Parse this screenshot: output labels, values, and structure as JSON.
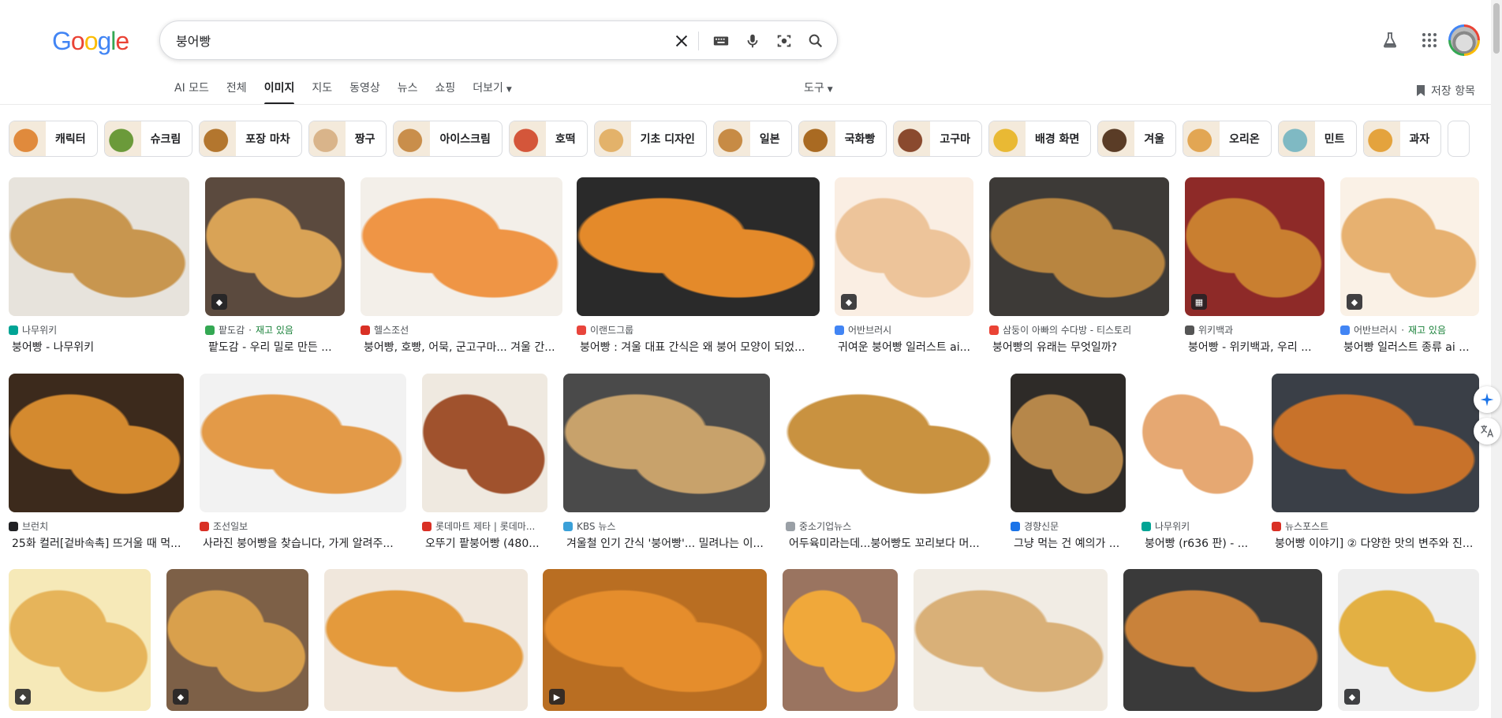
{
  "search": {
    "query": "붕어빵"
  },
  "logo": [
    "G",
    "o",
    "o",
    "g",
    "l",
    "e"
  ],
  "colors": {
    "blue": "#4285f4",
    "red": "#ea4335",
    "yellow": "#fbbc05",
    "green": "#34a853",
    "stock_green": "#188038"
  },
  "tabs": [
    {
      "label": "AI 모드",
      "active": false
    },
    {
      "label": "전체",
      "active": false
    },
    {
      "label": "이미지",
      "active": true
    },
    {
      "label": "지도",
      "active": false
    },
    {
      "label": "동영상",
      "active": false
    },
    {
      "label": "뉴스",
      "active": false
    },
    {
      "label": "쇼핑",
      "active": false
    },
    {
      "label": "더보기",
      "active": false
    }
  ],
  "tools_label": "도구",
  "saved_label": "저장 항목",
  "chips": [
    {
      "label": "캐릭터",
      "color": "#e08a3c"
    },
    {
      "label": "슈크림",
      "color": "#6b9a3a"
    },
    {
      "label": "포장 마차",
      "color": "#b3762e"
    },
    {
      "label": "짱구",
      "color": "#d9b48a"
    },
    {
      "label": "아이스크림",
      "color": "#c98e4b"
    },
    {
      "label": "호떡",
      "color": "#d4563a"
    },
    {
      "label": "기초 디자인",
      "color": "#e3b26a"
    },
    {
      "label": "일본",
      "color": "#c78b45"
    },
    {
      "label": "국화빵",
      "color": "#a96a22"
    },
    {
      "label": "고구마",
      "color": "#8a4a2e"
    },
    {
      "label": "배경 화면",
      "color": "#e9b934"
    },
    {
      "label": "겨울",
      "color": "#5a3c26"
    },
    {
      "label": "오리온",
      "color": "#e2a653"
    },
    {
      "label": "민트",
      "color": "#7fb9c3"
    },
    {
      "label": "과자",
      "color": "#e4a33d"
    }
  ],
  "results": [
    {
      "source": "나무위키",
      "stock": "",
      "title": "붕어빵 - 나무위키",
      "color": "#c8964f",
      "bg": "#e7e3dc",
      "fav": "#00a495",
      "badge": ""
    },
    {
      "source": "팥도감",
      "stock": "재고 있음",
      "title": "팥도감 - 우리 밀로 만든 ...",
      "color": "#d9a356",
      "bg": "#5b4a3e",
      "fav": "#34a853",
      "badge": "tag"
    },
    {
      "source": "헬스조선",
      "stock": "",
      "title": "붕어빵, 호빵, 어묵, 군고구마... 겨울 간...",
      "color": "#ef9545",
      "bg": "#f3efe9",
      "fav": "#d93025",
      "badge": ""
    },
    {
      "source": "이랜드그룹",
      "stock": "",
      "title": "붕어빵 : 겨울 대표 간식은 왜 붕어 모양이 되었...",
      "color": "#e48a2a",
      "bg": "#2a2a2a",
      "fav": "#e8453c",
      "badge": ""
    },
    {
      "source": "어반브러시",
      "stock": "",
      "title": "귀여운 붕어빵 일러스트 ai...",
      "color": "#edc49a",
      "bg": "#faeee3",
      "fav": "#4285f4",
      "badge": "tag"
    },
    {
      "source": "삼둥이 아빠의 수다방 - 티스토리",
      "stock": "",
      "title": "붕어빵의 유래는 무엇일까?",
      "color": "#b88540",
      "bg": "#3d3a37",
      "fav": "#ea4335",
      "badge": ""
    },
    {
      "source": "위키백과",
      "stock": "",
      "title": "붕어빵 - 위키백과, 우리 ...",
      "color": "#c97f30",
      "bg": "#8e2a28",
      "fav": "#555555",
      "badge": "img"
    },
    {
      "source": "어반브러시",
      "stock": "재고 있음",
      "title": "붕어빵 일러스트 종류 ai ...",
      "color": "#e7b170",
      "bg": "#faf1e6",
      "fav": "#4285f4",
      "badge": "tag"
    },
    {
      "source": "브런치",
      "stock": "",
      "title": "25화 컬러[겉바속촉] 뜨거울 때 먹...",
      "color": "#d48a2f",
      "bg": "#3c2a1c",
      "fav": "#202124",
      "badge": ""
    },
    {
      "source": "조선일보",
      "stock": "",
      "title": "사라진 붕어빵을 찾습니다, 가게 알려주...",
      "color": "#e39a48",
      "bg": "#f2f2f2",
      "fav": "#d93025",
      "badge": ""
    },
    {
      "source": "롯데마트 제타 | 롯데마...",
      "stock": "",
      "title": "오뚜기 팥붕어빵 (480...",
      "color": "#a0522d",
      "bg": "#efe9e0",
      "fav": "#d93025",
      "badge": ""
    },
    {
      "source": "KBS 뉴스",
      "stock": "",
      "title": "겨울철 인기 간식 '붕어빵'... 밀려나는 이...",
      "color": "#c8a26b",
      "bg": "#4a4a4a",
      "fav": "#3aa0d8",
      "badge": ""
    },
    {
      "source": "중소기업뉴스",
      "stock": "",
      "title": "어두육미라는데...붕어빵도 꼬리보다 머...",
      "color": "#c99240",
      "bg": "#ffffff",
      "fav": "#9aa0a6",
      "badge": ""
    },
    {
      "source": "경향신문",
      "stock": "",
      "title": "그냥 먹는 건 예의가 ...",
      "color": "#b6874a",
      "bg": "#2e2b28",
      "fav": "#1a73e8",
      "badge": ""
    },
    {
      "source": "나무위키",
      "stock": "",
      "title": "붕어빵 (r636 판) - ...",
      "color": "#e6a872",
      "bg": "#ffffff",
      "fav": "#00a495",
      "badge": ""
    },
    {
      "source": "뉴스포스트",
      "stock": "",
      "title": "붕어빵 이야기] ② 다양한 맛의 변주와 진...",
      "color": "#c8722a",
      "bg": "#3a3f47",
      "fav": "#d93025",
      "badge": ""
    },
    {
      "source": "",
      "stock": "",
      "title": "",
      "color": "#e6b45a",
      "bg": "#f6e9b8",
      "fav": "",
      "badge": "tag"
    },
    {
      "source": "",
      "stock": "",
      "title": "",
      "color": "#d9a04c",
      "bg": "#7d6047",
      "fav": "",
      "badge": "tag"
    },
    {
      "source": "",
      "stock": "",
      "title": "",
      "color": "#e49a3c",
      "bg": "#f0e7dc",
      "fav": "",
      "badge": ""
    },
    {
      "source": "",
      "stock": "",
      "title": "",
      "color": "#e58d2c",
      "bg": "#b96e22",
      "fav": "",
      "badge": "play"
    },
    {
      "source": "",
      "stock": "",
      "title": "",
      "color": "#f0a83a",
      "bg": "#9a7460",
      "fav": "",
      "badge": ""
    },
    {
      "source": "",
      "stock": "",
      "title": "",
      "color": "#d9b078",
      "bg": "#f1ece4",
      "fav": "",
      "badge": ""
    },
    {
      "source": "",
      "stock": "",
      "title": "",
      "color": "#c9823a",
      "bg": "#3a3a3a",
      "fav": "",
      "badge": ""
    },
    {
      "source": "",
      "stock": "",
      "title": "",
      "color": "#e3b043",
      "bg": "#eeeeee",
      "fav": "",
      "badge": "tag"
    }
  ]
}
